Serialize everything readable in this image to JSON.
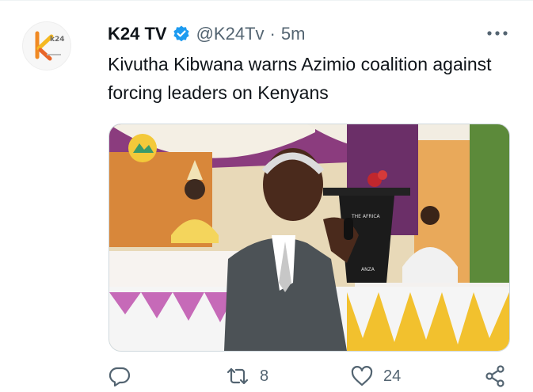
{
  "tweet": {
    "author_name": "K24 TV",
    "handle": "@K24Tv",
    "separator": "·",
    "time": "5m",
    "text": "Kivutha Kibwana warns Azimio coalition against forcing leaders on Kenyans",
    "avatar": {
      "logo_text": "k24",
      "icon": "k24-logo"
    },
    "verified_icon": "verified-badge-icon",
    "more_icon": "more-horizontal-icon"
  },
  "media": {
    "description_icon": "photo",
    "podium_text_1": "THE AFRICA",
    "podium_text_2": "ANZA"
  },
  "actions": {
    "reply": {
      "icon": "reply-icon",
      "count": ""
    },
    "retweet": {
      "icon": "retweet-icon",
      "count": "8"
    },
    "like": {
      "icon": "like-icon",
      "count": "24"
    },
    "share": {
      "icon": "share-icon"
    }
  },
  "colors": {
    "text_primary": "#0f1419",
    "text_secondary": "#536471",
    "verified": "#1d9bf0",
    "border": "#cfd9de",
    "brand_orange": "#f08a24",
    "brand_yellow": "#f5b923"
  }
}
